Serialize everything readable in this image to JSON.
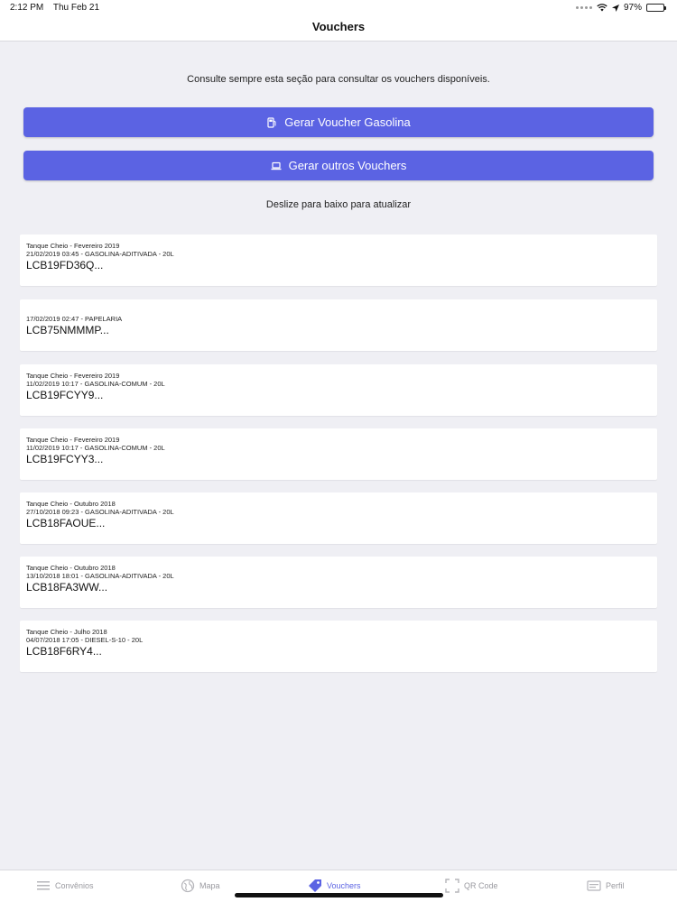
{
  "status": {
    "time": "2:12 PM",
    "date": "Thu Feb 21",
    "battery": "97%",
    "battery_level": 0.97
  },
  "nav": {
    "title": "Vouchers"
  },
  "intro": "Consulte sempre esta seção para consultar os vouchers disponíveis.",
  "buttons": {
    "gas": "Gerar Voucher Gasolina",
    "other": "Gerar outros Vouchers"
  },
  "refresh_hint": "Deslize para baixo para atualizar",
  "vouchers": [
    {
      "title": "Tanque Cheio - Fevereiro 2019",
      "details": "21/02/2019 03:45 - GASOLINA-ADITIVADA - 20L",
      "code": "LCB19FD36Q..."
    },
    {
      "title": "",
      "details": "17/02/2019 02:47 - PAPELARIA",
      "code": "LCB75NMMMP..."
    },
    {
      "title": "Tanque Cheio - Fevereiro 2019",
      "details": "11/02/2019 10:17 - GASOLINA-COMUM - 20L",
      "code": "LCB19FCYY9..."
    },
    {
      "title": "Tanque Cheio - Fevereiro 2019",
      "details": "11/02/2019 10:17 - GASOLINA-COMUM - 20L",
      "code": "LCB19FCYY3..."
    },
    {
      "title": "Tanque Cheio - Outubro 2018",
      "details": "27/10/2018 09:23 - GASOLINA-ADITIVADA - 20L",
      "code": "LCB18FAOUE..."
    },
    {
      "title": "Tanque Cheio - Outubro 2018",
      "details": "13/10/2018 18:01 - GASOLINA-ADITIVADA - 20L",
      "code": "LCB18FA3WW..."
    },
    {
      "title": "Tanque Cheio - Julho 2018",
      "details": "04/07/2018 17:05 - DIESEL-S-10 - 20L",
      "code": "LCB18F6RY4..."
    }
  ],
  "tabs": [
    {
      "label": "Convênios",
      "icon": "list-icon"
    },
    {
      "label": "Mapa",
      "icon": "globe-icon"
    },
    {
      "label": "Vouchers",
      "icon": "tag-icon"
    },
    {
      "label": "QR Code",
      "icon": "qr-scan-icon"
    },
    {
      "label": "Perfil",
      "icon": "profile-icon"
    }
  ],
  "colors": {
    "accent": "#5b63e3",
    "background": "#efeff4",
    "inactive_tab": "#9a9aa0"
  }
}
